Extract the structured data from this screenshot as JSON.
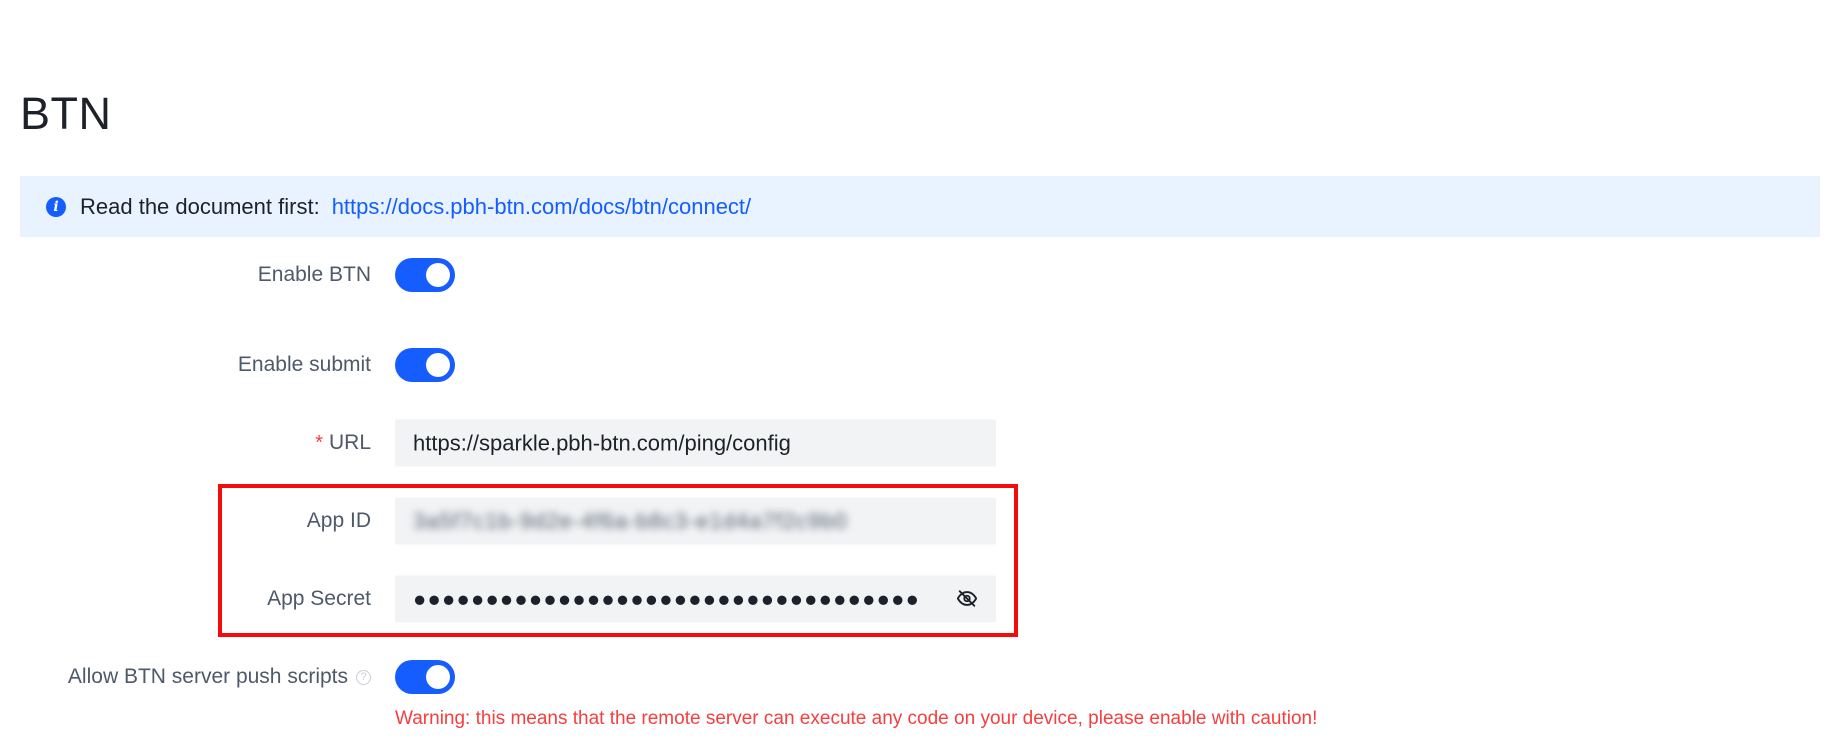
{
  "page": {
    "title": "BTN"
  },
  "info_banner": {
    "icon": "info-icon",
    "text": "Read the document first:",
    "link": "https://docs.pbh-btn.com/docs/btn/connect/"
  },
  "form": {
    "enable_btn": {
      "label": "Enable BTN",
      "checked": true
    },
    "enable_submit": {
      "label": "Enable submit",
      "checked": true
    },
    "url": {
      "required_mark": "*",
      "label": "URL",
      "value": "https://sparkle.pbh-btn.com/ping/config"
    },
    "app_id": {
      "label": "App ID",
      "value": "3a5f7c1b-9d2e-4f6a-b8c3-e1d4a7f2c9b0"
    },
    "app_secret": {
      "label": "App Secret",
      "value": "●●●●●●●●●●●●●●●●●●●●●●●●●●●●●●●●●●●",
      "toggle_icon": "eye-off-icon"
    },
    "allow_push_scripts": {
      "label": "Allow BTN server push scripts",
      "help_icon": "question-circle-icon",
      "help_glyph": "?",
      "checked": true,
      "warning": "Warning: this means that the remote server can execute any code on your device, please enable with caution!"
    }
  },
  "colors": {
    "primary": "#165dff",
    "highlight_border": "#f20c0c",
    "warning": "#f53f3f",
    "banner_bg": "#e8f3ff"
  }
}
